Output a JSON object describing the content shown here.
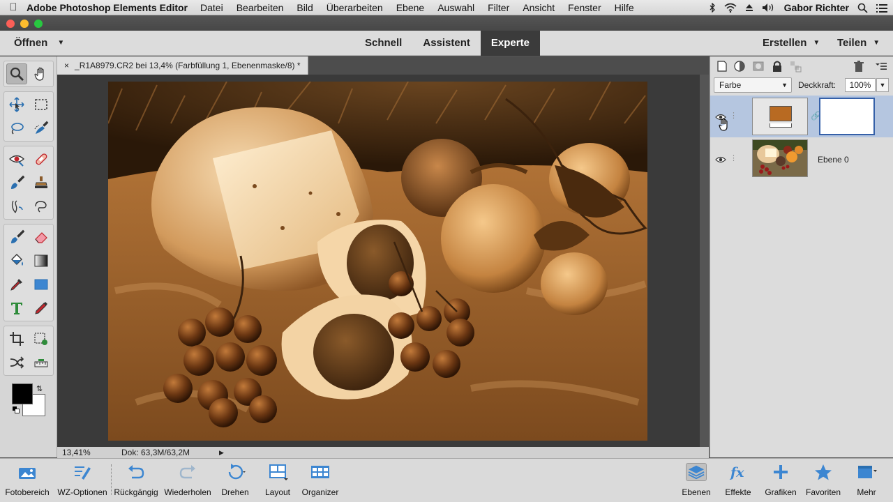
{
  "menubar": {
    "app_name": "Adobe Photoshop Elements Editor",
    "items": [
      "Datei",
      "Bearbeiten",
      "Bild",
      "Überarbeiten",
      "Ebene",
      "Auswahl",
      "Filter",
      "Ansicht",
      "Fenster",
      "Hilfe"
    ],
    "user": "Gabor Richter"
  },
  "modebar": {
    "open_label": "Öffnen",
    "modes": [
      "Schnell",
      "Assistent",
      "Experte"
    ],
    "active_mode": "Experte",
    "create_label": "Erstellen",
    "share_label": "Teilen"
  },
  "document": {
    "tab_title": "_R1A8979.CR2 bei 13,4% (Farbfüllung 1, Ebenenmaske/8) *",
    "zoom": "13,41%",
    "doc_size": "Dok: 63,3M/63,2M"
  },
  "layers_panel": {
    "blend_mode": "Farbe",
    "opacity_label": "Deckkraft:",
    "opacity_value": "100%",
    "layers": [
      {
        "name": "",
        "fill_color": "#b86a22",
        "selected": true
      },
      {
        "name": "Ebene 0",
        "selected": false
      }
    ]
  },
  "bottombar": {
    "items": [
      {
        "label": "Fotobereich",
        "icon": "photo-bin-icon"
      },
      {
        "label": "WZ-Optionen",
        "icon": "tool-options-icon"
      },
      {
        "label": "Rückgängig",
        "icon": "undo-icon"
      },
      {
        "label": "Wiederholen",
        "icon": "redo-icon"
      },
      {
        "label": "Drehen",
        "icon": "rotate-icon"
      },
      {
        "label": "Layout",
        "icon": "layout-icon"
      },
      {
        "label": "Organizer",
        "icon": "organizer-icon"
      },
      {
        "label": "Ebenen",
        "icon": "layers-icon"
      },
      {
        "label": "Effekte",
        "icon": "fx-icon"
      },
      {
        "label": "Grafiken",
        "icon": "plus-icon"
      },
      {
        "label": "Favoriten",
        "icon": "star-icon"
      },
      {
        "label": "Mehr",
        "icon": "more-icon"
      }
    ]
  },
  "colors": {
    "sepia_dark": "#3b220d",
    "sepia_mid": "#a0622a",
    "sepia_light": "#f3d3a4",
    "selection_blue": "#b5c6e0"
  }
}
